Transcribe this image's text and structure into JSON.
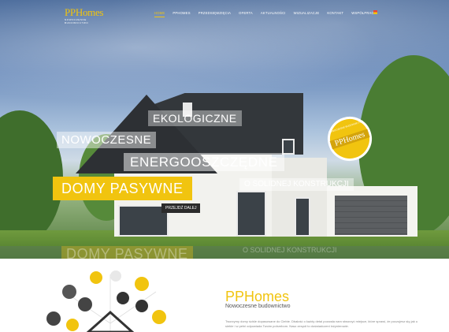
{
  "header": {
    "logo_main": "PPHomes",
    "logo_sub": "NOWOCZESNE BUDOWNICTWO",
    "nav": [
      "HOME",
      "PPHOMES",
      "PRZEDSIĘWZIĘCIA",
      "OFERTA",
      "AKTUALNOŚCI",
      "WIZUALIZACJE",
      "KONTAKT",
      "WSPÓŁPRACA"
    ],
    "active_index": 0
  },
  "hero": {
    "line1": "EKOLOGICZNE",
    "line2": "NOWOCZESNE",
    "line3": "ENERGOOSZCZĘDNE",
    "line4": "DOMY PASYWNE",
    "line5": "O SOLIDNEJ KONSTRUKCJI",
    "button": "PRZEJDŹ DALEJ",
    "badge_text": "PPHomes",
    "badge_arc": "NOWOCZESNE BUDOWNICTWO"
  },
  "intro": {
    "title": "PPHomes",
    "subtitle": "Nowoczesne budownictwo",
    "body": "Tworzymy domy ściśle dopasowane do Ciebie. Dbałość o każdy detal pozwala nam stworzyć miejsce, które sprawi, że poczujesz się jak u siebie i w pełni odpowiada Twoim potrzebom. Nasz zespół to doświadczeni inżynierowie."
  },
  "colors": {
    "accent": "#f1c40f",
    "dark": "#2b2b2b"
  }
}
